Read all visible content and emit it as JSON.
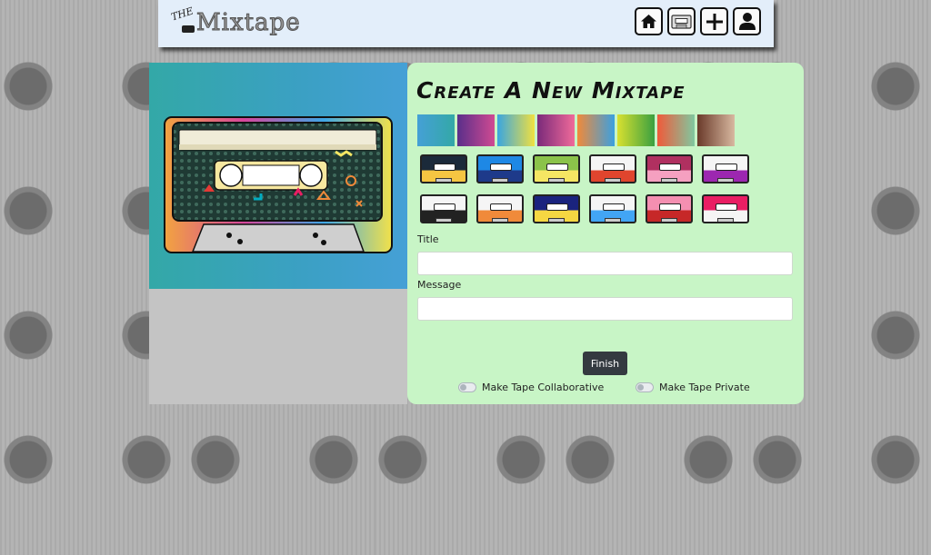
{
  "app": {
    "logo_small": "THE",
    "logo_word": "Mixtape"
  },
  "nav": {
    "buttons": [
      {
        "icon": "home-icon"
      },
      {
        "icon": "cassette-icon"
      },
      {
        "icon": "plus-icon"
      },
      {
        "icon": "user-icon"
      }
    ]
  },
  "page": {
    "title": "Create A New Mixtape"
  },
  "color_swatches": [
    [
      "#45a0d6",
      "#33a8a7"
    ],
    [
      "#5a2f8a",
      "#d04a92"
    ],
    [
      "#3aa6e0",
      "#f0e040"
    ],
    [
      "#7a2a7a",
      "#f06a9a"
    ],
    [
      "#f08a3a",
      "#3aa0e0"
    ],
    [
      "#d8e030",
      "#3aa040"
    ],
    [
      "#f05a3a",
      "#80c8a0"
    ],
    [
      "#6a3a2a",
      "#d8b8a0"
    ]
  ],
  "tape_designs": [
    [
      "#1b2a3a",
      "#f5c542"
    ],
    [
      "#1e88e5",
      "#1e3a8a"
    ],
    [
      "#8bc34a",
      "#f5e663"
    ],
    [
      "#f5f5f5",
      "#e0452e"
    ],
    [
      "#b03060",
      "#f5a0c0"
    ],
    [
      "#f5f5f5",
      "#9c27b0"
    ],
    [
      "#f5f5f5",
      "#222222"
    ],
    [
      "#f5f5f5",
      "#f08a3a"
    ],
    [
      "#1a237e",
      "#f5d742"
    ],
    [
      "#f5f5f5",
      "#42a5f5"
    ],
    [
      "#f48fb1",
      "#c62828"
    ],
    [
      "#e91e63",
      "#f5f5f5"
    ]
  ],
  "form": {
    "title_label": "Title",
    "title_value": "",
    "message_label": "Message",
    "message_value": "",
    "finish_label": "Finish",
    "collab_label": "Make Tape Collaborative",
    "private_label": "Make Tape Private"
  },
  "colors": {
    "nav_bg": "#e3eefa",
    "panel_green": "#c8f5c6",
    "button_dark": "#343a40"
  }
}
